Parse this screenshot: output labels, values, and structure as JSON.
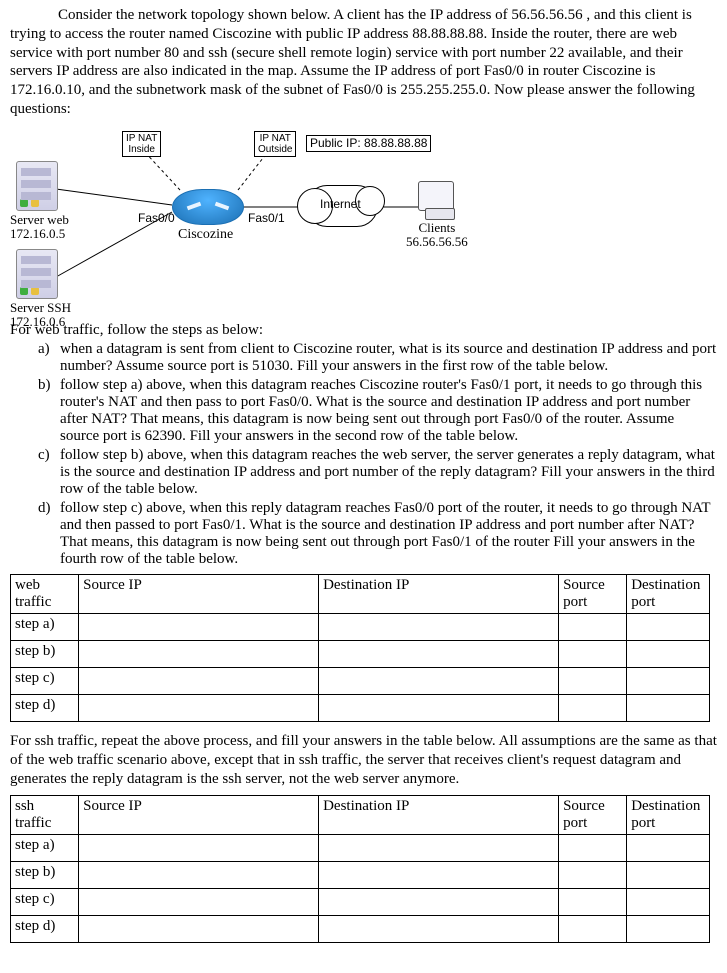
{
  "intro": "Consider the network topology shown below. A client has the IP address of 56.56.56.56 , and this client is trying to access the router named Ciscozine with public IP address 88.88.88.88. Inside the router, there are web service with port number 80 and ssh (secure shell remote login) service with port number 22 available, and their servers IP address are also indicated in the map. Assume the IP address of port Fas0/0 in router Ciscozine is 172.16.0.10, and the subnetwork mask of the subnet of Fas0/0 is 255.255.255.0. Now please answer the following questions:",
  "topology": {
    "server_web_label": "Server web",
    "server_web_ip": "172.16.0.5",
    "server_ssh_label": "Server SSH",
    "server_ssh_ip": "172.16.0.6",
    "router_name": "Ciscozine",
    "port_inside": "Fas0/0",
    "port_outside": "Fas0/1",
    "nat_inside": "IP NAT\nInside",
    "nat_outside": "IP NAT\nOutside",
    "public_ip_label": "Public IP: 88.88.88.88",
    "internet_label": "Internet",
    "clients_label": "Clients",
    "client_ip": "56.56.56.56"
  },
  "web_heading": "For web traffic, follow the steps as below:",
  "steps": {
    "a": "when a datagram is sent from client to Ciscozine router, what is its source and destination IP address and port number? Assume source port is 51030. Fill your answers in the first row of the table below.",
    "b": "follow step a) above, when this datagram reaches Ciscozine router's Fas0/1 port, it needs to go through this router's NAT and then pass to port Fas0/0. What is the source and destination IP address and port number after NAT? That means, this datagram is now being sent out through port Fas0/0 of the router. Assume source port is 62390.   Fill your answers in the second row of the table below.",
    "c": "follow step b) above, when this datagram reaches the web server, the server generates a reply datagram, what is the source and destination IP address and port number of the reply datagram? Fill your answers in the third row of the table below.",
    "d": "follow step c) above, when this reply datagram reaches Fas0/0 port of the router, it needs to go through NAT and then passed to port Fas0/1. What is the source and destination IP address and port number after NAT? That means, this datagram is now being sent out through port Fas0/1 of the router Fill your answers in the fourth row of the table below."
  },
  "table_headers": {
    "src_ip": "Source IP",
    "dst_ip": "Destination IP",
    "src_port": "Source port",
    "dst_port": "Destination port"
  },
  "web_table_label": "web traffic",
  "ssh_table_label": "ssh traffic",
  "row_labels": {
    "a": "step a)",
    "b": "step b)",
    "c": "step c)",
    "d": "step d)"
  },
  "ssh_intro": "For ssh traffic, repeat the above process, and fill your answers in the table below. All assumptions are the same as that of the web traffic scenario above, except that in ssh traffic, the server that receives client's request datagram and generates the reply datagram is the ssh server, not the web server anymore.",
  "letters": {
    "a": "a)",
    "b": "b)",
    "c": "c)",
    "d": "d)"
  }
}
